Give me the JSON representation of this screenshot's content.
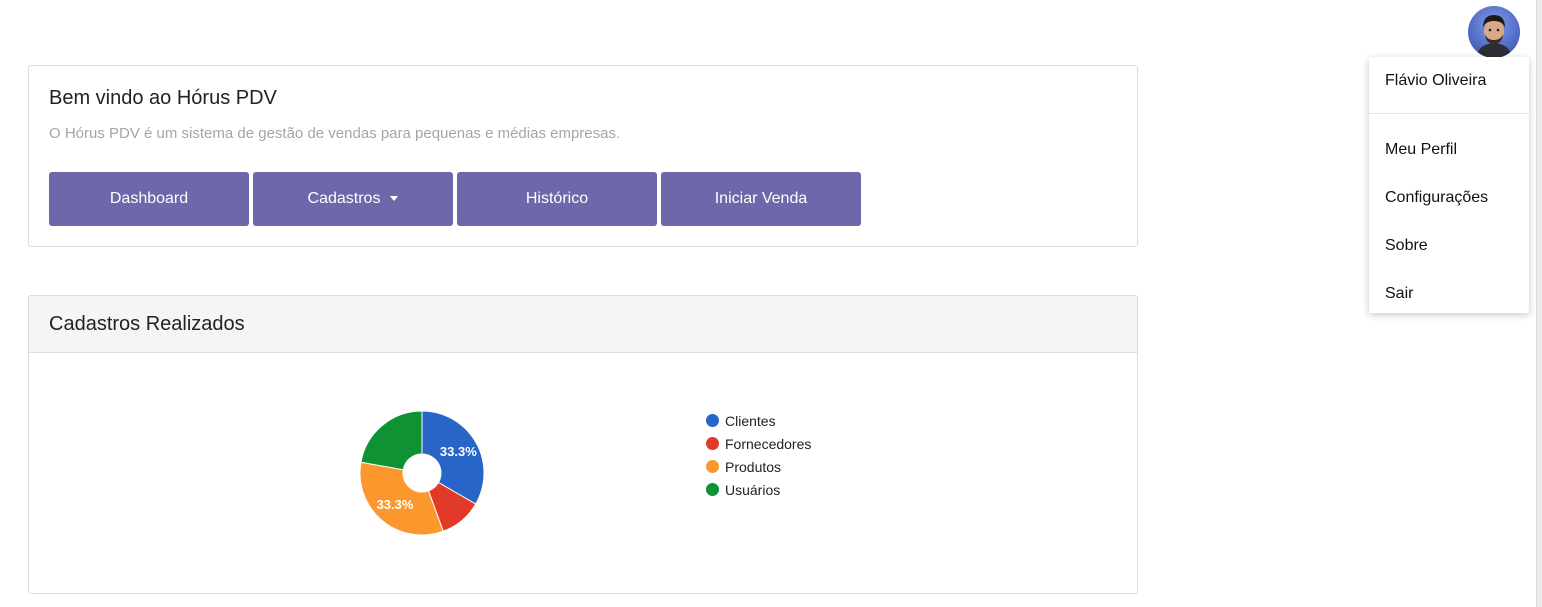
{
  "welcome": {
    "title": "Bem vindo ao Hórus PDV",
    "subtitle": "O Hórus PDV é um sistema de gestão de vendas para pequenas e médias empresas.",
    "buttons": {
      "dashboard": "Dashboard",
      "cadastros": "Cadastros",
      "historico": "Histórico",
      "iniciar_venda": "Iniciar Venda"
    }
  },
  "chart_card": {
    "title": "Cadastros Realizados"
  },
  "user_menu": {
    "user_name": "Flávio Oliveira",
    "items": {
      "perfil": "Meu Perfil",
      "configuracoes": "Configurações",
      "sobre": "Sobre",
      "sair": "Sair"
    }
  },
  "colors": {
    "button": "#6e67a9",
    "clientes": "#2766c8",
    "fornecedores": "#e23a28",
    "produtos": "#fb972c",
    "usuarios": "#0f9234"
  },
  "chart_data": {
    "type": "pie",
    "donut": true,
    "categories": [
      "Clientes",
      "Fornecedores",
      "Produtos",
      "Usuários"
    ],
    "values": [
      33.3,
      11.1,
      33.3,
      22.2
    ],
    "data_labels": [
      "33.3%",
      "",
      "33.3%",
      ""
    ],
    "colors": [
      "#2766c8",
      "#e23a28",
      "#fb972c",
      "#0f9234"
    ],
    "legend_position": "right"
  }
}
